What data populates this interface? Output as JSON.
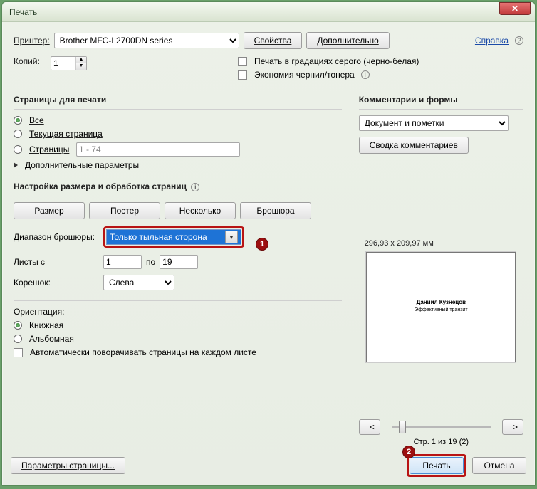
{
  "window": {
    "title": "Печать"
  },
  "printer": {
    "label": "Принтер:",
    "selected": "Brother MFC-L2700DN series",
    "properties_btn": "Свойства",
    "advanced_btn": "Дополнительно"
  },
  "help_link": "Справка",
  "copies": {
    "label": "Копий:",
    "value": "1"
  },
  "grayscale": {
    "label": "Печать в градациях серого (черно-белая)",
    "checked": false
  },
  "ink_save": {
    "label": "Экономия чернил/тонера",
    "checked": false
  },
  "pages_section": {
    "title": "Страницы для печати",
    "all": "Все",
    "current": "Текущая страница",
    "range_label": "Страницы",
    "range_value": "1 - 74",
    "more": "Дополнительные параметры",
    "selected": "all"
  },
  "sizing": {
    "title": "Настройка размера и обработка страниц",
    "tabs": {
      "size": "Размер",
      "poster": "Постер",
      "multi": "Несколько",
      "booklet": "Брошюра"
    },
    "range_label": "Диапазон брошюры:",
    "range_value": "Только тыльная сторона",
    "sheets_label": "Листы с",
    "sheets_from": "1",
    "sheets_to_label": "по",
    "sheets_to": "19",
    "spine_label": "Корешок:",
    "spine_value": "Слева"
  },
  "orientation": {
    "title": "Ориентация:",
    "portrait": "Книжная",
    "landscape": "Альбомная",
    "auto_rotate": "Автоматически поворачивать страницы на каждом листе",
    "selected": "portrait"
  },
  "comments": {
    "title": "Комментарии и формы",
    "value": "Документ и пометки",
    "summary_btn": "Сводка комментариев"
  },
  "preview": {
    "dimensions": "296,93 x 209,97 мм",
    "line1": "Даниил Кузнецов",
    "line2": "Эффективный транзит",
    "indicator": "Стр. 1 из 19 (2)"
  },
  "footer": {
    "page_setup": "Параметры страницы...",
    "print": "Печать",
    "cancel": "Отмена"
  },
  "annotations": {
    "a1": "1",
    "a2": "2"
  }
}
